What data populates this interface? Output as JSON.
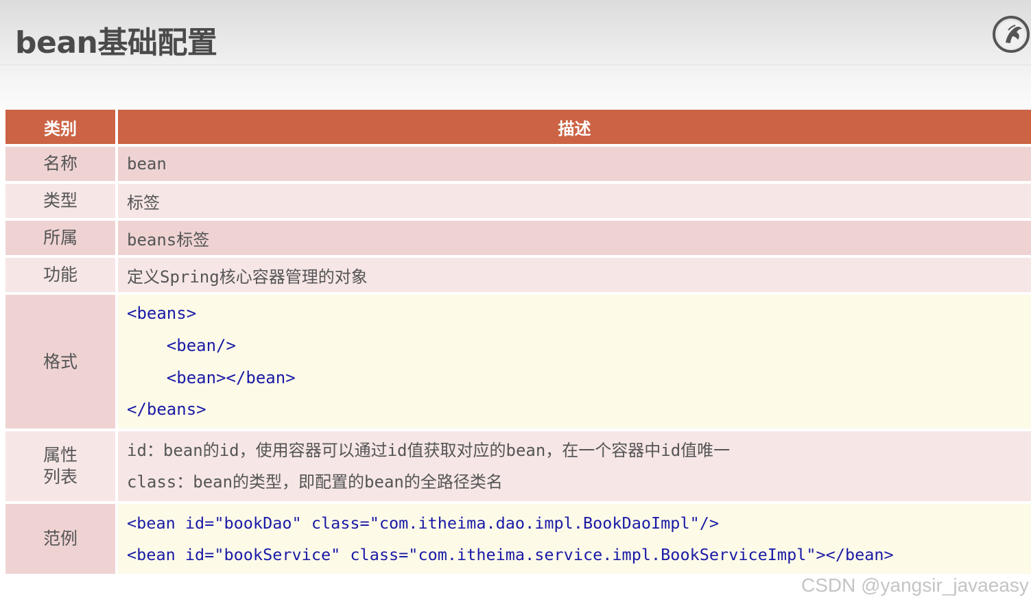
{
  "title": "bean基础配置",
  "logo_icon": "horse-circle-logo",
  "table": {
    "headers": [
      "类别",
      "描述"
    ],
    "rows": [
      {
        "category": "名称",
        "description": "bean"
      },
      {
        "category": "类型",
        "description": "标签"
      },
      {
        "category": "所属",
        "description": "beans标签"
      },
      {
        "category": "功能",
        "description": "定义Spring核心容器管理的对象"
      }
    ],
    "format": {
      "category": "格式",
      "lines": [
        "<beans>",
        "    <bean/>",
        "    <bean></bean>",
        "</beans>"
      ]
    },
    "attributes": {
      "category_line1": "属性",
      "category_line2": "列表",
      "lines": [
        "id：bean的id，使用容器可以通过id值获取对应的bean，在一个容器中id值唯一",
        "class：bean的类型，即配置的bean的全路径类名"
      ]
    },
    "example": {
      "category": "范例",
      "lines": [
        "<bean id=\"bookDao\" class=\"com.itheima.dao.impl.BookDaoImpl\"/>",
        "<bean id=\"bookService\" class=\"com.itheima.service.impl.BookServiceImpl\"></bean>"
      ]
    }
  },
  "colors": {
    "header_bg": "#cb6344",
    "row_dark": "#efd3d3",
    "row_light": "#f6e6e6",
    "code_bg": "#fdfbe8",
    "code_keyword": "#1a1aa6"
  },
  "watermark": "CSDN @yangsir_javaeasy"
}
